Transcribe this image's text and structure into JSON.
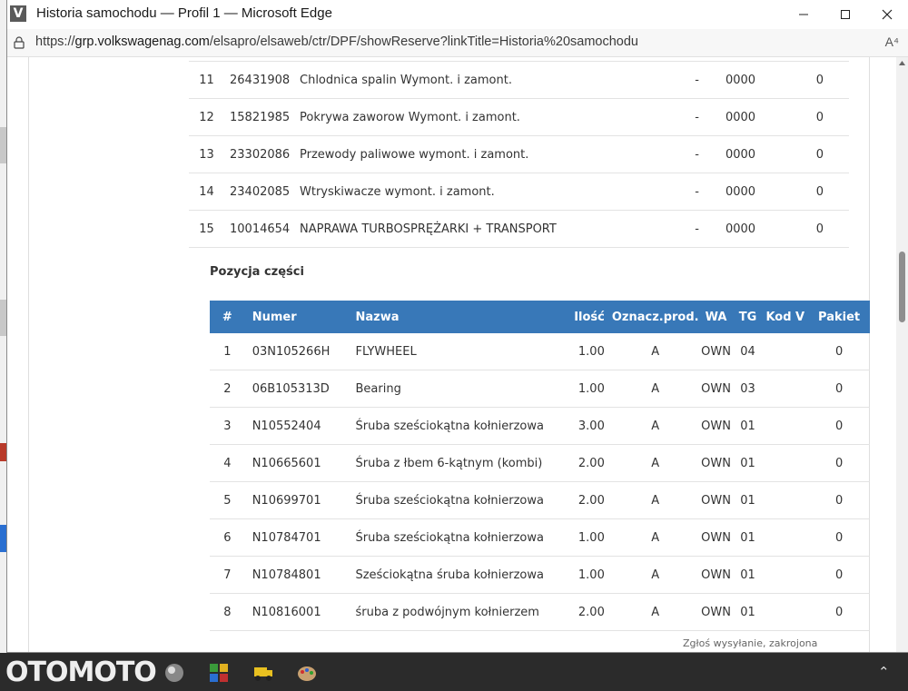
{
  "window": {
    "title": "Historia samochodu — Profil 1 — Microsoft Edge",
    "app_icon_letter": "V"
  },
  "address_bar": {
    "url_prefix": "https://",
    "url_host": "grp.volkswagenag.com",
    "url_path": "/elsapro/elsaweb/ctr/DPF/showReserve?linkTitle=Historia%20samochodu",
    "read_aloud_label": "A⁴"
  },
  "operations": [
    {
      "no": "11",
      "number": "26431908",
      "name": "Chlodnica spalin Wymont. i zamont.",
      "dash": "-",
      "code": "0000",
      "val": "0"
    },
    {
      "no": "12",
      "number": "15821985",
      "name": "Pokrywa zaworow Wymont. i zamont.",
      "dash": "-",
      "code": "0000",
      "val": "0"
    },
    {
      "no": "13",
      "number": "23302086",
      "name": "Przewody paliwowe wymont. i zamont.",
      "dash": "-",
      "code": "0000",
      "val": "0"
    },
    {
      "no": "14",
      "number": "23402085",
      "name": "Wtryskiwacze wymont. i zamont.",
      "dash": "-",
      "code": "0000",
      "val": "0"
    },
    {
      "no": "15",
      "number": "10014654",
      "name": "NAPRAWA TURBOSPRĘŻARKI + TRANSPORT",
      "dash": "-",
      "code": "0000",
      "val": "0"
    }
  ],
  "parts_section": {
    "title": "Pozycja części",
    "headers": [
      "#",
      "Numer",
      "Nazwa",
      "Ilość",
      "Oznacz.prod.",
      "WA",
      "TG",
      "Kod V",
      "Pakiet"
    ],
    "rows": [
      {
        "no": "1",
        "number": "03N105266H",
        "name": "FLYWHEEL",
        "qty": "1.00",
        "mark": "A",
        "wa": "OWN",
        "tg": "04",
        "kodv": "",
        "pakiet": "0"
      },
      {
        "no": "2",
        "number": "06B105313D",
        "name": "Bearing",
        "qty": "1.00",
        "mark": "A",
        "wa": "OWN",
        "tg": "03",
        "kodv": "",
        "pakiet": "0"
      },
      {
        "no": "3",
        "number": "N10552404",
        "name": "Śruba sześciokątna kołnierzowa",
        "qty": "3.00",
        "mark": "A",
        "wa": "OWN",
        "tg": "01",
        "kodv": "",
        "pakiet": "0"
      },
      {
        "no": "4",
        "number": "N10665601",
        "name": "Śruba z łbem 6-kątnym (kombi)",
        "qty": "2.00",
        "mark": "A",
        "wa": "OWN",
        "tg": "01",
        "kodv": "",
        "pakiet": "0"
      },
      {
        "no": "5",
        "number": "N10699701",
        "name": "Śruba sześciokątna kołnierzowa",
        "qty": "2.00",
        "mark": "A",
        "wa": "OWN",
        "tg": "01",
        "kodv": "",
        "pakiet": "0"
      },
      {
        "no": "6",
        "number": "N10784701",
        "name": "Śruba sześciokątna kołnierzowa",
        "qty": "1.00",
        "mark": "A",
        "wa": "OWN",
        "tg": "01",
        "kodv": "",
        "pakiet": "0"
      },
      {
        "no": "7",
        "number": "N10784801",
        "name": "Sześciokątna śruba kołnierzowa",
        "qty": "1.00",
        "mark": "A",
        "wa": "OWN",
        "tg": "01",
        "kodv": "",
        "pakiet": "0"
      },
      {
        "no": "8",
        "number": "N10816001",
        "name": "śruba z podwójnym kołnierzem",
        "qty": "2.00",
        "mark": "A",
        "wa": "OWN",
        "tg": "01",
        "kodv": "",
        "pakiet": "0"
      }
    ]
  },
  "taskbar": {
    "watermark_logo": "OTOMOTO",
    "overlay_text": "Zgłoś wysyłanie, zakrojona"
  },
  "colors": {
    "table_header_bg": "#3878b8",
    "taskbar_bg": "#2b2b2b"
  }
}
